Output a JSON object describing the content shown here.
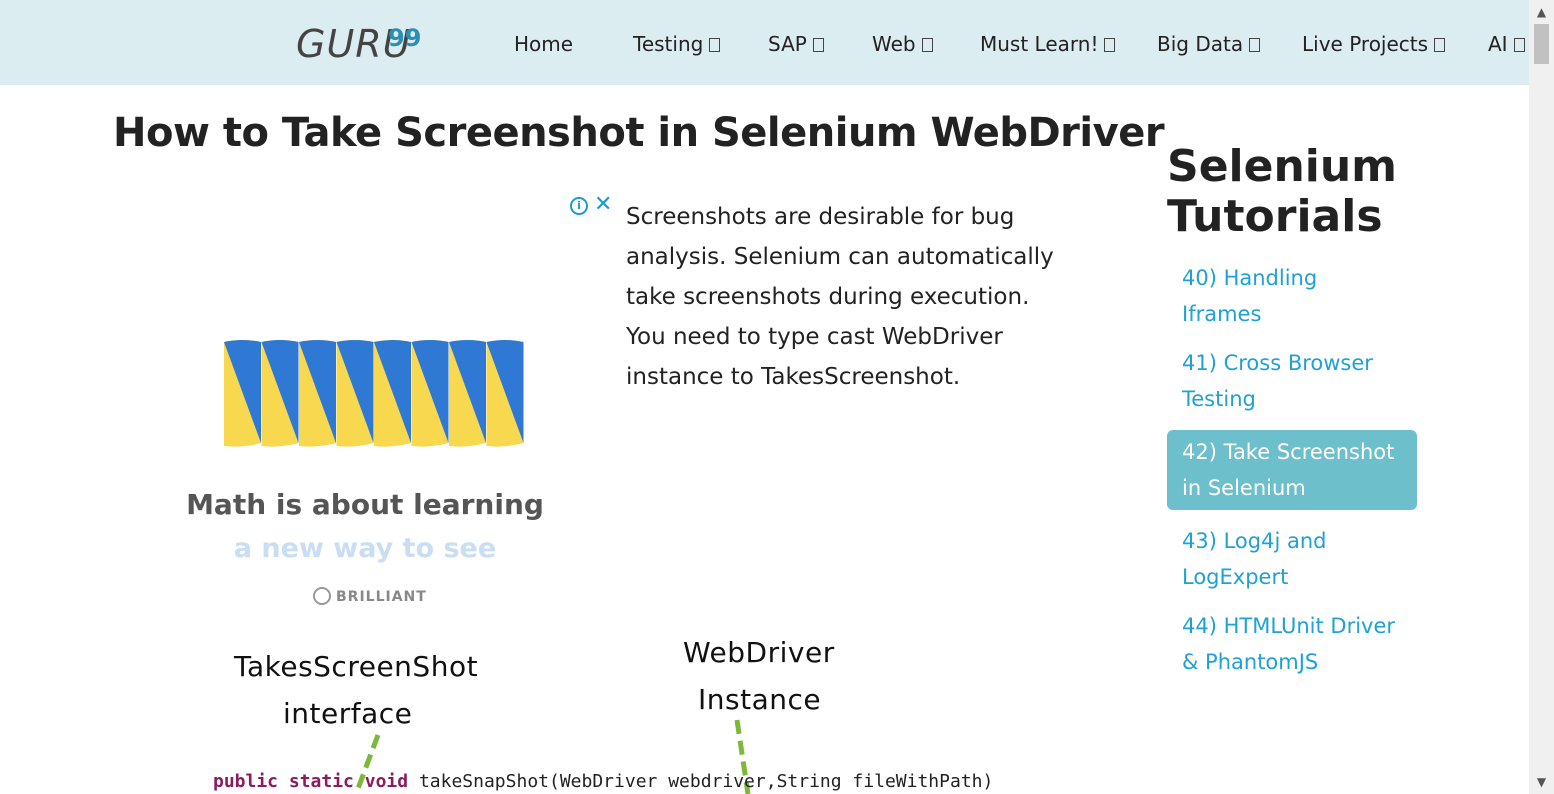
{
  "header": {
    "logo_text": "GURU",
    "logo_number": "99",
    "nav": [
      {
        "label": "Home",
        "has_dropdown": false
      },
      {
        "label": "Testing",
        "has_dropdown": true
      },
      {
        "label": "SAP",
        "has_dropdown": true
      },
      {
        "label": "Web",
        "has_dropdown": true
      },
      {
        "label": "Must Learn!",
        "has_dropdown": true
      },
      {
        "label": "Big Data",
        "has_dropdown": true
      },
      {
        "label": "Live Projects",
        "has_dropdown": true
      },
      {
        "label": "AI",
        "has_dropdown": true
      }
    ]
  },
  "article": {
    "title": "How to Take Screenshot in Selenium WebDriver",
    "intro": "Screenshots are desirable for bug analysis. Selenium can automatically take screenshots during execution. You need to type cast WebDriver instance to TakesScreenshot."
  },
  "ad": {
    "headline": "Math is about learning",
    "subline": "a new way to see",
    "brand": "BRILLIANT",
    "colors": {
      "blue": "#2f79d4",
      "yellow": "#f7d84f"
    }
  },
  "sidebar": {
    "title_line1": "Selenium",
    "title_line2": "Tutorials",
    "items": [
      {
        "label": "40) Handling Iframes",
        "active": false
      },
      {
        "label": "41) Cross Browser Testing",
        "active": false
      },
      {
        "label": "42) Take Screenshot in Selenium",
        "active": true
      },
      {
        "label": "43) Log4j and LogExpert",
        "active": false
      },
      {
        "label": "44) HTMLUnit Driver & PhantomJS",
        "active": false
      }
    ]
  },
  "diagram": {
    "label1_line1": "TakesScreenShot",
    "label1_line2": "interface",
    "label2_line1": "WebDriver",
    "label2_line2": "Instance",
    "code_kw1": "public",
    "code_kw2": "static",
    "code_kw3": "void",
    "code_rest": "takeSnapShot(WebDriver webdriver,String fileWithPath)"
  },
  "colors": {
    "header_bg": "#dcedf2",
    "link": "#1fa1d6",
    "active_bg": "#6dbfcc",
    "dash_green": "#7db83a"
  }
}
